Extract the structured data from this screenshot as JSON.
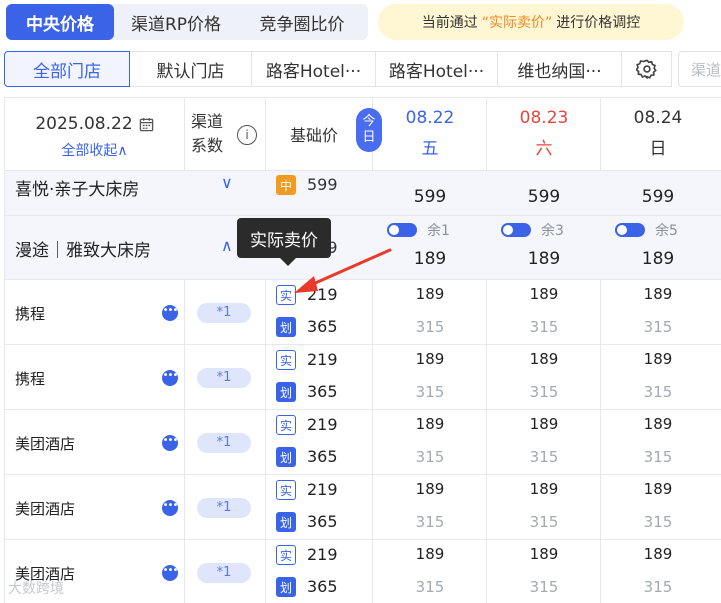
{
  "top_tabs": [
    "中央价格",
    "渠道RP价格",
    "竞争圈比价"
  ],
  "notice": {
    "prefix": "当前通过",
    "highlight": "“实际卖价”",
    "suffix": "进行价格调控"
  },
  "store_tabs": [
    "全部门店",
    "默认门店",
    "路客Hotel···",
    "路客Hotel···",
    "维也纳国···"
  ],
  "channel_placeholder": "渠道",
  "header": {
    "date": "2025.08.22",
    "collapse_all": "全部收起∧",
    "coef_label_1": "渠道",
    "coef_label_2": "系数",
    "info_icon": "i",
    "base_label": "基础价",
    "today_1": "今",
    "today_2": "日"
  },
  "days": [
    {
      "date": "08.22",
      "weekday": "五"
    },
    {
      "date": "08.23",
      "weekday": "六"
    },
    {
      "date": "08.24",
      "weekday": "日"
    }
  ],
  "rooms": [
    {
      "name": "喜悦·亲子大床房",
      "chevron": "∨",
      "badge": "中",
      "base": "599",
      "prices": [
        "599",
        "599",
        "599"
      ]
    },
    {
      "name": "漫途｜雅致大床房",
      "chevron": "∧",
      "base": "219",
      "remain": [
        "余1",
        "余3",
        "余5"
      ],
      "prices": [
        "189",
        "189",
        "189"
      ]
    }
  ],
  "channels": [
    {
      "name": "携程",
      "coef": "*1",
      "actual": "219",
      "strike": "365",
      "actual_days": [
        "189",
        "189",
        "189"
      ],
      "strike_days": [
        "315",
        "315",
        "315"
      ]
    },
    {
      "name": "携程",
      "coef": "*1",
      "actual": "219",
      "strike": "365",
      "actual_days": [
        "189",
        "189",
        "189"
      ],
      "strike_days": [
        "315",
        "315",
        "315"
      ]
    },
    {
      "name": "美团酒店",
      "coef": "*1",
      "actual": "219",
      "strike": "365",
      "actual_days": [
        "189",
        "189",
        "189"
      ],
      "strike_days": [
        "315",
        "315",
        "315"
      ]
    },
    {
      "name": "美团酒店",
      "coef": "*1",
      "actual": "219",
      "strike": "365",
      "actual_days": [
        "189",
        "189",
        "189"
      ],
      "strike_days": [
        "315",
        "315",
        "315"
      ]
    },
    {
      "name": "美团酒店",
      "coef": "*1",
      "actual": "219",
      "strike": "365",
      "actual_days": [
        "189",
        "189",
        "189"
      ],
      "strike_days": [
        "315",
        "315",
        "315"
      ]
    }
  ],
  "badges": {
    "actual": "实",
    "strike": "划"
  },
  "tooltip": "实际卖价",
  "watermark": "大数跨境",
  "colors": {
    "primary": "#3a63e8",
    "weekend": "#e8453c",
    "accent_orange": "#f39a22",
    "arrow": "#e8392b"
  }
}
